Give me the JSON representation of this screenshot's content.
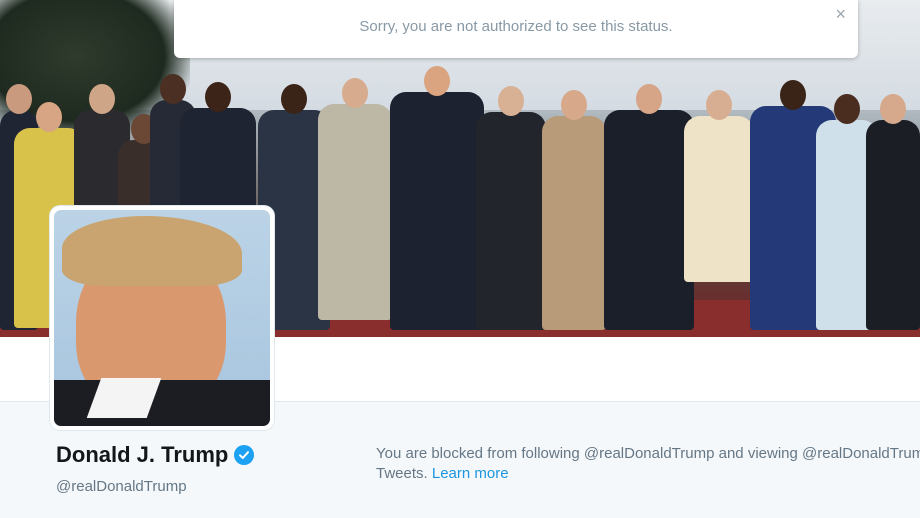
{
  "notification": {
    "message": "Sorry, you are not authorized to see this status.",
    "close_glyph": "×"
  },
  "profile": {
    "name": "Donald J. Trump",
    "handle": "@realDonaldTrump",
    "verified": true
  },
  "blocked_notice": {
    "line1": "You are blocked from following @realDonaldTrump and viewing @realDonaldTrump's",
    "line2_prefix": "Tweets. ",
    "learn_more": "Learn more"
  },
  "colors": {
    "accent": "#1da1f2",
    "link": "#1b95e0",
    "muted_text": "#657786",
    "background": "#f5f8fa"
  },
  "icons": {
    "close": "close-icon",
    "verified": "verified-badge-icon"
  }
}
